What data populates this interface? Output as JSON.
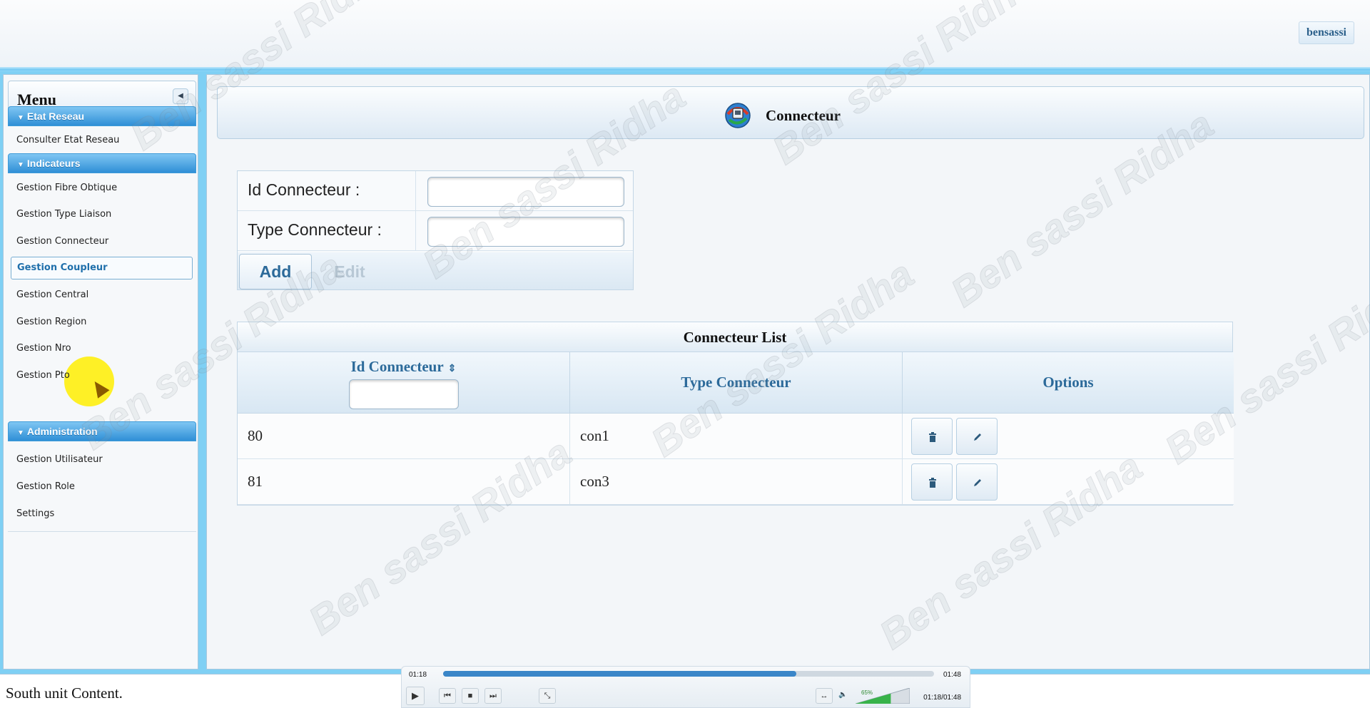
{
  "header": {
    "username": "bensassi"
  },
  "menu": {
    "title": "Menu",
    "sections": [
      {
        "label": "Etat Reseau",
        "items": [
          "Consulter Etat Reseau"
        ]
      },
      {
        "label": "Indicateurs",
        "items": [
          "Gestion Fibre Obtique",
          "Gestion Type Liaison",
          "Gestion Connecteur",
          "Gestion Coupleur",
          "Gestion Central",
          "Gestion Region",
          "Gestion Nro",
          "Gestion Pto"
        ]
      },
      {
        "label": "Administration",
        "items": [
          "Gestion Utilisateur",
          "Gestion Role",
          "Settings"
        ]
      }
    ],
    "active_item": "Gestion Coupleur"
  },
  "page": {
    "title": "Connecteur"
  },
  "form": {
    "id_label": "Id Connecteur :",
    "id_value": "",
    "type_label": "Type Connecteur :",
    "type_value": "",
    "add_label": "Add",
    "edit_label": "Edit"
  },
  "table": {
    "caption": "Connecteur List",
    "columns": [
      "Id Connecteur",
      "Type Connecteur",
      "Options"
    ],
    "filter_value": "",
    "rows": [
      {
        "id": "80",
        "type": "con1"
      },
      {
        "id": "81",
        "type": "con3"
      }
    ]
  },
  "south": {
    "text": "South unit Content."
  },
  "player": {
    "current_time": "01:18",
    "total_time": "01:48",
    "combined_time": "01:18/01:48",
    "progress": 0.72,
    "volume_label": "65%",
    "volume": 0.65
  },
  "watermark": {
    "text": "Ben sassi Ridha"
  },
  "colors": {
    "accent": "#2f8fd6",
    "frame": "#7fd0f4",
    "header_text": "#2c6a9a",
    "highlight": "#ffee00"
  }
}
